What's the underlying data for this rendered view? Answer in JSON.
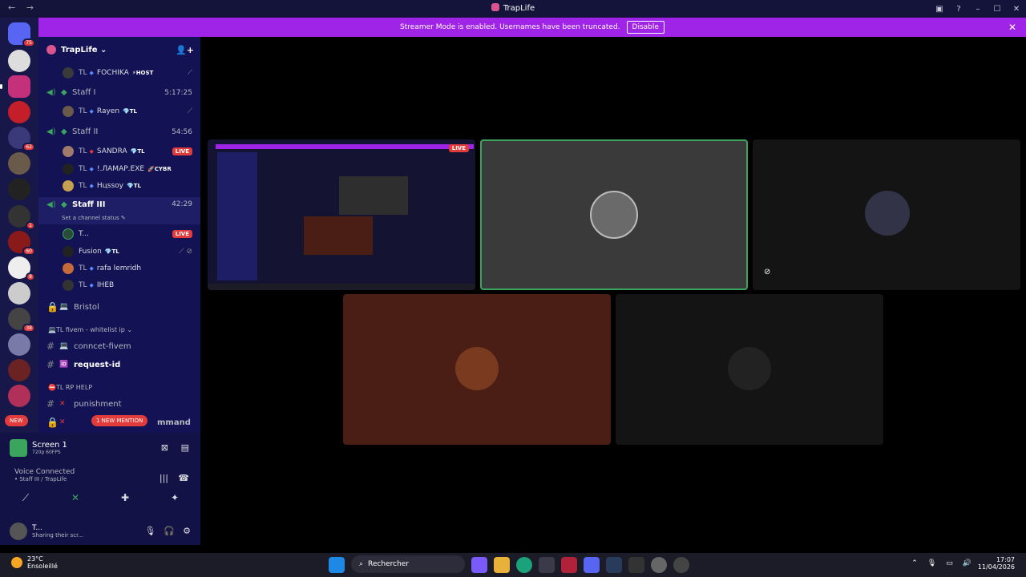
{
  "titlebar": {
    "back": "←",
    "forward": "→",
    "app_name": "TrapLife"
  },
  "window_controls": {
    "minimize": "–",
    "maximize": "☐",
    "close": "✕"
  },
  "banner": {
    "text": "Streamer Mode is enabled. Usernames have been truncated.",
    "button": "Disable",
    "close": "✕"
  },
  "guilds": {
    "badges": [
      "75",
      "62",
      "1",
      "60",
      "8",
      "38"
    ],
    "new_label": "NEW"
  },
  "server": {
    "name": "TrapLife ⌄"
  },
  "voice_rows": [
    {
      "type": "member",
      "prefix": "TL",
      "name": "FOCHIKA",
      "tag": "⚡HOST",
      "right": "⟋"
    },
    {
      "type": "channel",
      "name": "Staff I",
      "time": "5:17:25"
    },
    {
      "type": "member",
      "prefix": "TL",
      "name": "Rayen",
      "tag": "💎TL",
      "right": "⟋"
    },
    {
      "type": "channel",
      "name": "Staff II",
      "time": "54:56"
    },
    {
      "type": "member",
      "prefix": "TL",
      "name": "SANDRA",
      "tag": "💎TL",
      "live": "LIVE"
    },
    {
      "type": "member",
      "prefix": "TL",
      "name": "!.ЛΑΜΑΡ.EXE",
      "tag": "🚀CYBR"
    },
    {
      "type": "member",
      "prefix": "TL",
      "name": "Hцѕѕоу",
      "tag": "💎TL"
    },
    {
      "type": "channel",
      "name": "Staff III",
      "time": "42:29"
    },
    {
      "type": "status",
      "text": "Set a channel status ✎"
    },
    {
      "type": "member",
      "prefix": "",
      "name": "T...",
      "tag": "",
      "live": "LIVE"
    },
    {
      "type": "member",
      "prefix": "",
      "name": "Fusion",
      "tag": "💎TL",
      "right": "⟋ ⊘"
    },
    {
      "type": "member",
      "prefix": "TL",
      "name": "rafa lemridh",
      "tag": ""
    },
    {
      "type": "member",
      "prefix": "TL",
      "name": "IHEB",
      "tag": ""
    }
  ],
  "text_channels": {
    "bristol": "Bristol",
    "cat_fivem": "TL fivem - whitelist ip ⌄",
    "connect": "conncet-fivem",
    "request": "request-id",
    "cat_help": "TL RP HELP",
    "punishment": "punishment",
    "command": "mmand",
    "mention_pill": "1 NEW MENTION"
  },
  "panel": {
    "stream_title": "Screen 1",
    "stream_sub": "720p 60FPS",
    "voice_status": "Voice Connected",
    "voice_loc": "• Staff III / TrapLife",
    "user_name": "T...",
    "user_status": "Sharing their scr...",
    "icons": [
      "⟋",
      "✕",
      "✚",
      "✦"
    ]
  },
  "stage": {
    "live": "LIVE"
  },
  "taskbar": {
    "temp": "23°C",
    "weather": "Ensoleillé",
    "search": "Rechercher",
    "time": "17:07",
    "date": "11/04/2026"
  },
  "colors": {
    "accent": "#a024e8",
    "sidebar": "#121254",
    "live": "#e23b3b",
    "voice_green": "#3ba55d"
  }
}
